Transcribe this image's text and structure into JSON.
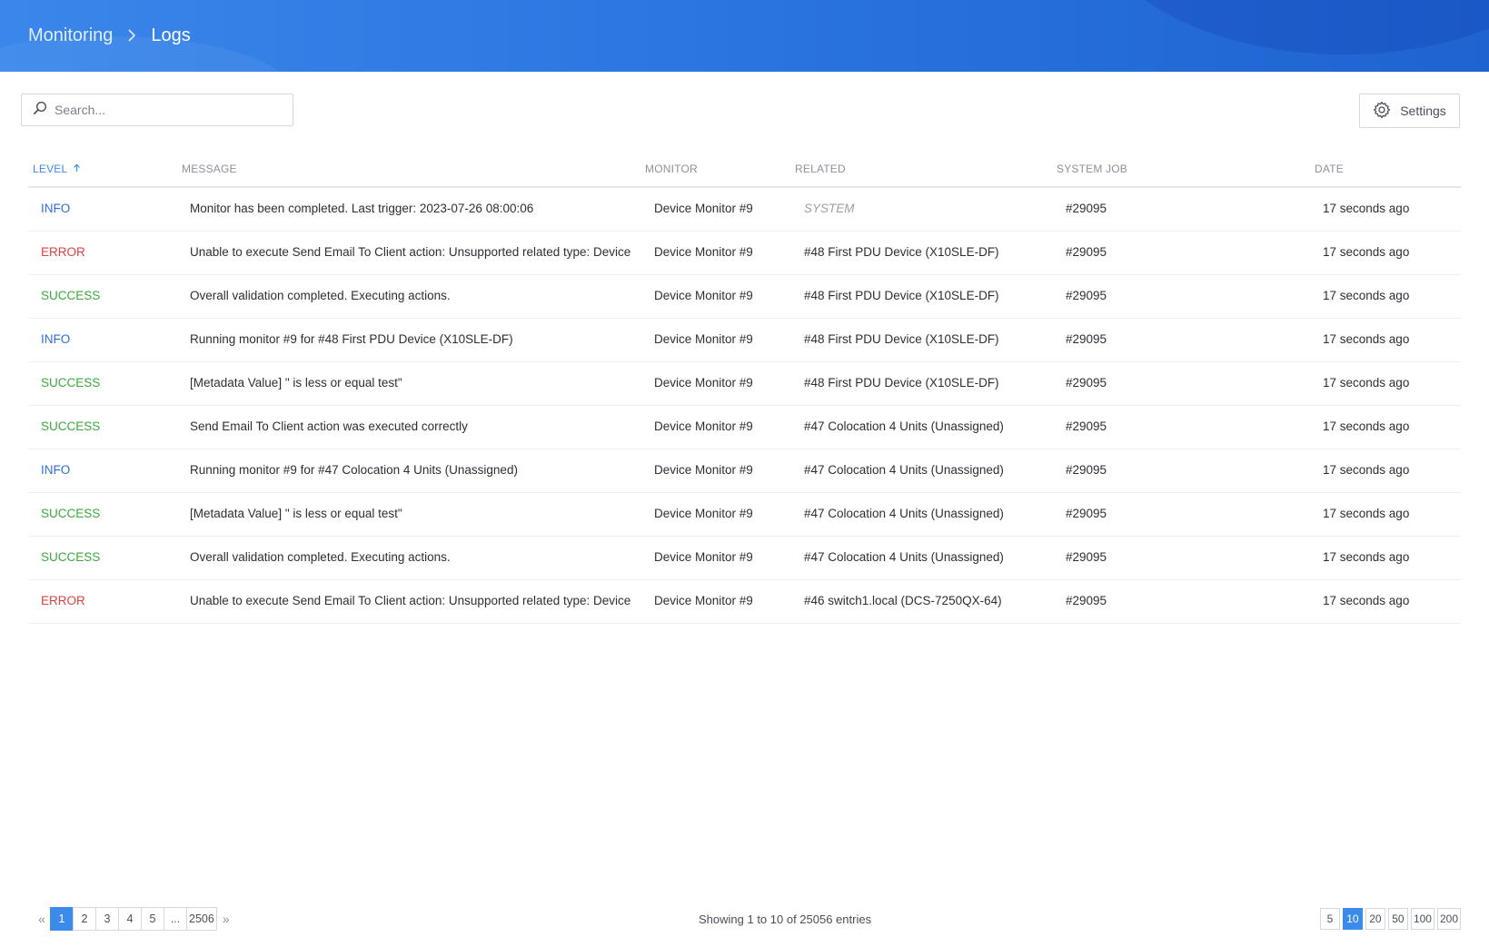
{
  "breadcrumb": {
    "parent": "Monitoring",
    "current": "Logs"
  },
  "search": {
    "placeholder": "Search..."
  },
  "toolbar": {
    "settings_label": "Settings"
  },
  "colors": {
    "accent": "#3b8beb",
    "info": "#2e6fd8",
    "error": "#e04040",
    "success": "#3ba93b"
  },
  "table": {
    "columns": [
      "LEVEL",
      "MESSAGE",
      "MONITOR",
      "RELATED",
      "SYSTEM JOB",
      "DATE"
    ],
    "sorted_column": "LEVEL",
    "sort_direction": "ascending",
    "rows": [
      {
        "level": "INFO",
        "message": "Monitor has been completed. Last trigger: 2023-07-26 08:00:06",
        "monitor": "Device Monitor #9",
        "related": "SYSTEM",
        "job": "#29095",
        "date": "17 seconds ago"
      },
      {
        "level": "ERROR",
        "message": "Unable to execute Send Email To Client action: Unsupported related type: Device",
        "monitor": "Device Monitor #9",
        "related": "#48 First PDU Device (X10SLE-DF)",
        "job": "#29095",
        "date": "17 seconds ago"
      },
      {
        "level": "SUCCESS",
        "message": "Overall validation completed. Executing actions.",
        "monitor": "Device Monitor #9",
        "related": "#48 First PDU Device (X10SLE-DF)",
        "job": "#29095",
        "date": "17 seconds ago"
      },
      {
        "level": "INFO",
        "message": "Running monitor #9 for #48 First PDU Device (X10SLE-DF)",
        "monitor": "Device Monitor #9",
        "related": "#48 First PDU Device (X10SLE-DF)",
        "job": "#29095",
        "date": "17 seconds ago"
      },
      {
        "level": "SUCCESS",
        "message": "[Metadata Value] \" is less or equal test\"",
        "monitor": "Device Monitor #9",
        "related": "#48 First PDU Device (X10SLE-DF)",
        "job": "#29095",
        "date": "17 seconds ago"
      },
      {
        "level": "SUCCESS",
        "message": "Send Email To Client action was executed correctly",
        "monitor": "Device Monitor #9",
        "related": "#47 Colocation 4 Units (Unassigned)",
        "job": "#29095",
        "date": "17 seconds ago"
      },
      {
        "level": "INFO",
        "message": "Running monitor #9 for #47 Colocation 4 Units (Unassigned)",
        "monitor": "Device Monitor #9",
        "related": "#47 Colocation 4 Units (Unassigned)",
        "job": "#29095",
        "date": "17 seconds ago"
      },
      {
        "level": "SUCCESS",
        "message": "[Metadata Value] \" is less or equal test\"",
        "monitor": "Device Monitor #9",
        "related": "#47 Colocation 4 Units (Unassigned)",
        "job": "#29095",
        "date": "17 seconds ago"
      },
      {
        "level": "SUCCESS",
        "message": "Overall validation completed. Executing actions.",
        "monitor": "Device Monitor #9",
        "related": "#47 Colocation 4 Units (Unassigned)",
        "job": "#29095",
        "date": "17 seconds ago"
      },
      {
        "level": "ERROR",
        "message": "Unable to execute Send Email To Client action: Unsupported related type: Device",
        "monitor": "Device Monitor #9",
        "related": "#46 switch1.local (DCS-7250QX-64)",
        "job": "#29095",
        "date": "17 seconds ago"
      }
    ]
  },
  "pagination": {
    "pages": [
      "1",
      "2",
      "3",
      "4",
      "5",
      "...",
      "2506"
    ],
    "current_page": "1",
    "prev_icon": "double-chevron-left-icon",
    "next_icon": "double-chevron-right-icon",
    "summary": "Showing 1 to 10 of 25056 entries",
    "per_page_options": [
      "5",
      "10",
      "20",
      "50",
      "100",
      "200"
    ],
    "per_page_selected": "10"
  }
}
